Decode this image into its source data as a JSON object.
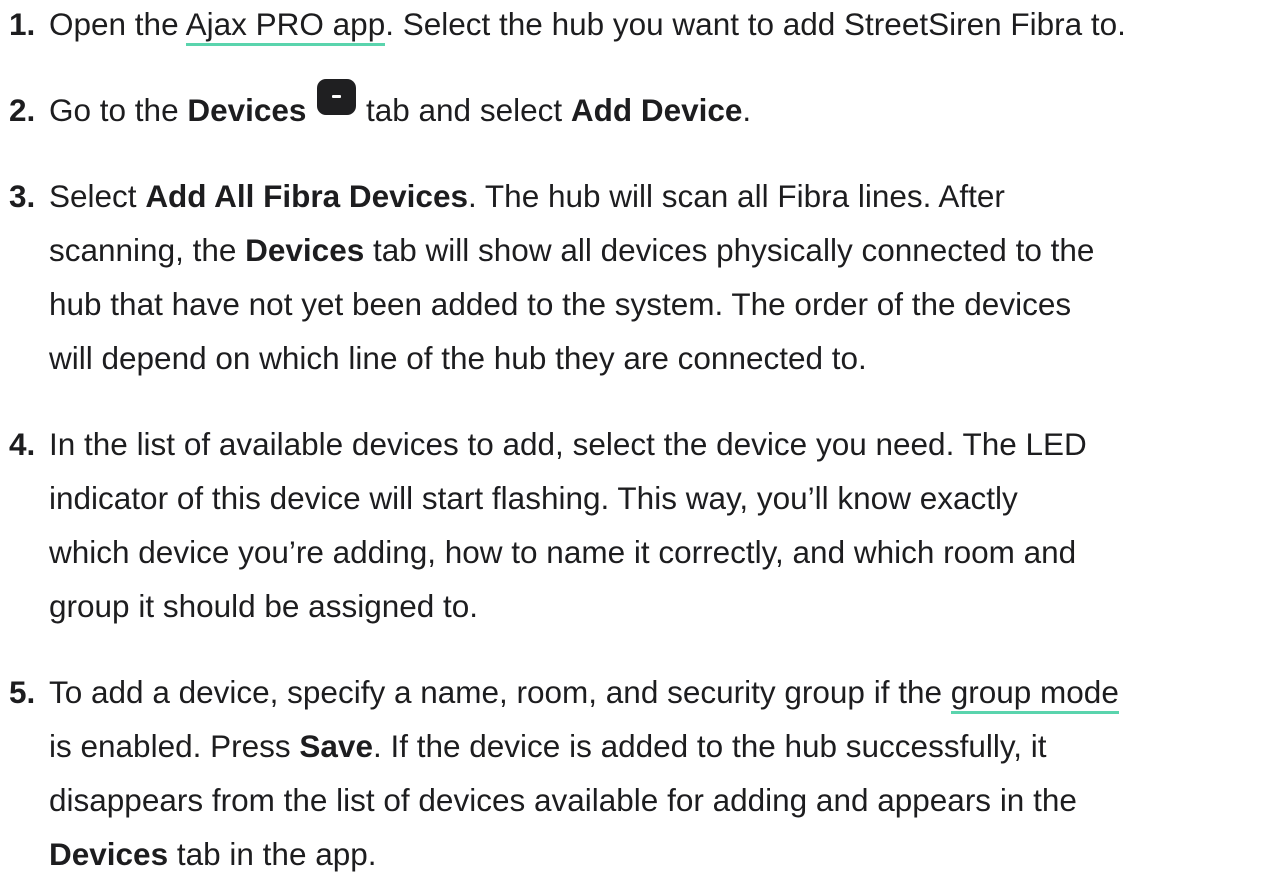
{
  "steps": [
    {
      "number": "1.",
      "parts": {
        "t1": "Open the ",
        "link": "Ajax PRO app",
        "t2": ". Select the hub you want to add StreetSiren Fibra to."
      }
    },
    {
      "number": "2.",
      "parts": {
        "t1": "Go to the ",
        "b1": "Devices",
        "t2": " tab and select ",
        "b2": "Add Device",
        "t3": "."
      }
    },
    {
      "number": "3.",
      "parts": {
        "t1": "Select ",
        "b1": "Add All Fibra Devices",
        "t2": ". The hub will scan all Fibra lines. After",
        "t3": "scanning, the ",
        "b2": "Devices",
        "t4": " tab will show all devices physically connected to the",
        "t5": "hub that have not yet been added to the system. The order of the devices",
        "t6": "will depend on which line of the hub they are connected to."
      }
    },
    {
      "number": "4.",
      "parts": {
        "t1": "In the list of available devices to add, select the device you need. The LED",
        "t2": "indicator of this device will start flashing. This way, you’ll know exactly",
        "t3": "which device you’re adding, how to name it correctly, and which room and",
        "t4": "group it should be assigned to."
      }
    },
    {
      "number": "5.",
      "parts": {
        "t1": "To add a device, specify a name, room, and security group if the ",
        "link": "group mode",
        "t2": "is enabled. Press ",
        "b1": "Save",
        "t3": ". If the device is added to the hub successfully, it",
        "t4": "disappears from the list of devices available for adding and appears in the",
        "b2": "Devices",
        "t5": " tab in the app."
      }
    }
  ],
  "icons": {
    "devices_tab": "devices-tab-icon"
  },
  "colors": {
    "text": "#1d1d1f",
    "link_underline": "#5ad4ad",
    "icon_bg": "#1f1f21"
  }
}
